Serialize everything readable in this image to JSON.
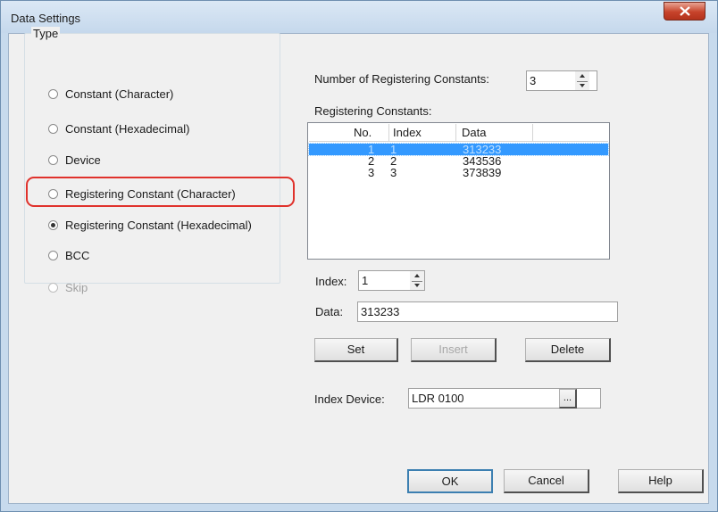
{
  "window": {
    "title": "Data Settings"
  },
  "type_group": {
    "legend": "Type",
    "options": [
      {
        "label": "Constant (Character)",
        "checked": false,
        "enabled": true
      },
      {
        "label": "Constant (Hexadecimal)",
        "checked": false,
        "enabled": true
      },
      {
        "label": "Device",
        "checked": false,
        "enabled": true
      },
      {
        "label": "Registering Constant (Character)",
        "checked": false,
        "enabled": true
      },
      {
        "label": "Registering Constant (Hexadecimal)",
        "checked": true,
        "enabled": true
      },
      {
        "label": "BCC",
        "checked": false,
        "enabled": true
      },
      {
        "label": "Skip",
        "checked": false,
        "enabled": false
      }
    ]
  },
  "registering": {
    "count_label": "Number of Registering Constants:",
    "count_value": "3",
    "list_label": "Registering Constants:",
    "columns": [
      "No.",
      "Index",
      "Data"
    ],
    "rows": [
      {
        "no": "1",
        "index": "1",
        "data": "313233",
        "selected": true
      },
      {
        "no": "2",
        "index": "2",
        "data": "343536",
        "selected": false
      },
      {
        "no": "3",
        "index": "3",
        "data": "373839",
        "selected": false
      }
    ]
  },
  "editor": {
    "index_label": "Index:",
    "index_value": "1",
    "data_label": "Data:",
    "data_value": "313233",
    "set_label": "Set",
    "insert_label": "Insert",
    "delete_label": "Delete",
    "index_device_label": "Index Device:",
    "index_device_value": "LDR 0100",
    "browse_label": "..."
  },
  "footer": {
    "ok_label": "OK",
    "cancel_label": "Cancel",
    "help_label": "Help"
  },
  "colors": {
    "highlight": "#e0322c",
    "selection": "#3399ff",
    "close_button": "#c7432b"
  }
}
